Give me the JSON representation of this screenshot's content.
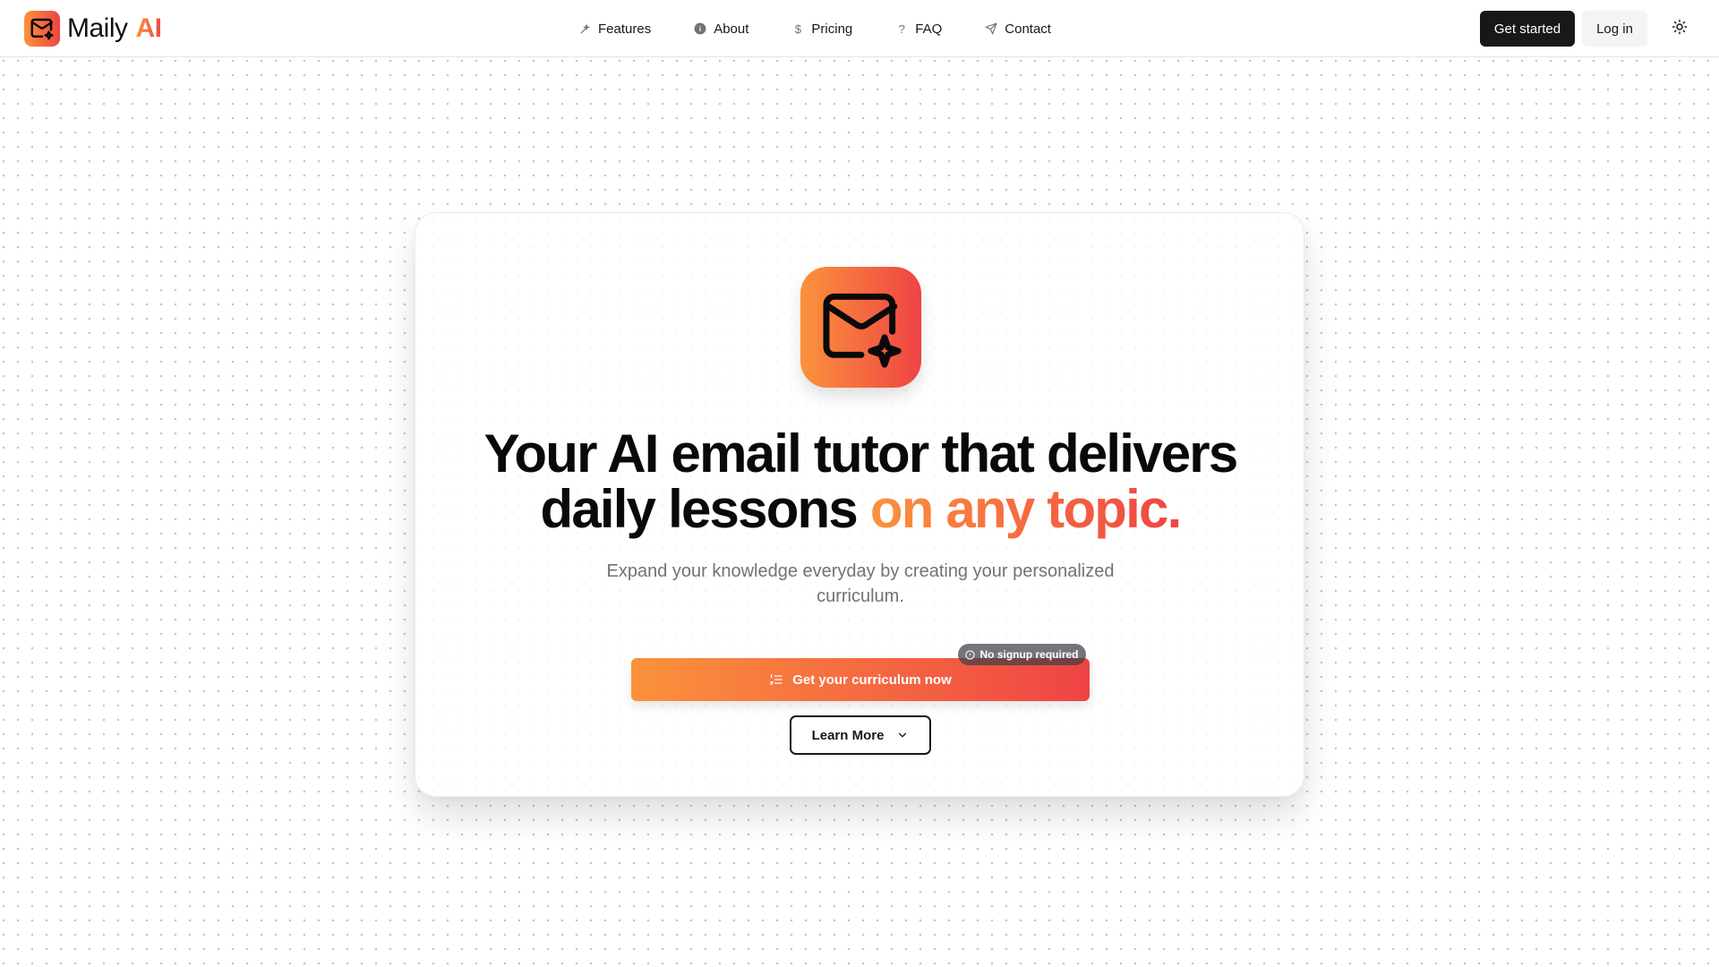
{
  "brand": {
    "name": "Maily",
    "accent": "AI",
    "gradient_start": "#fb923c",
    "gradient_end": "#ef4444",
    "logo_icon": "mail-sparkle-icon"
  },
  "nav": {
    "items": [
      {
        "label": "Features",
        "icon": "sparkle-wand-icon"
      },
      {
        "label": "About",
        "icon": "info-circle-icon"
      },
      {
        "label": "Pricing",
        "icon": "dollar-icon"
      },
      {
        "label": "FAQ",
        "icon": "question-icon"
      },
      {
        "label": "Contact",
        "icon": "send-icon"
      }
    ]
  },
  "header_actions": {
    "get_started": "Get started",
    "log_in": "Log in",
    "theme_toggle_icon": "sun-icon"
  },
  "hero": {
    "icon": "mail-sparkle-icon",
    "headline_line1": "Your AI email tutor that delivers",
    "headline_line2_plain": "daily lessons ",
    "headline_line2_accent": "on any topic.",
    "subtitle": "Expand your knowledge everyday by creating your personalized curriculum.",
    "cta_label": "Get your curriculum now",
    "cta_icon": "list-ordered-icon",
    "badge_label": "No signup required",
    "badge_icon": "info-circle-icon",
    "learn_more_label": "Learn More",
    "learn_more_icon": "chevron-down-icon"
  }
}
